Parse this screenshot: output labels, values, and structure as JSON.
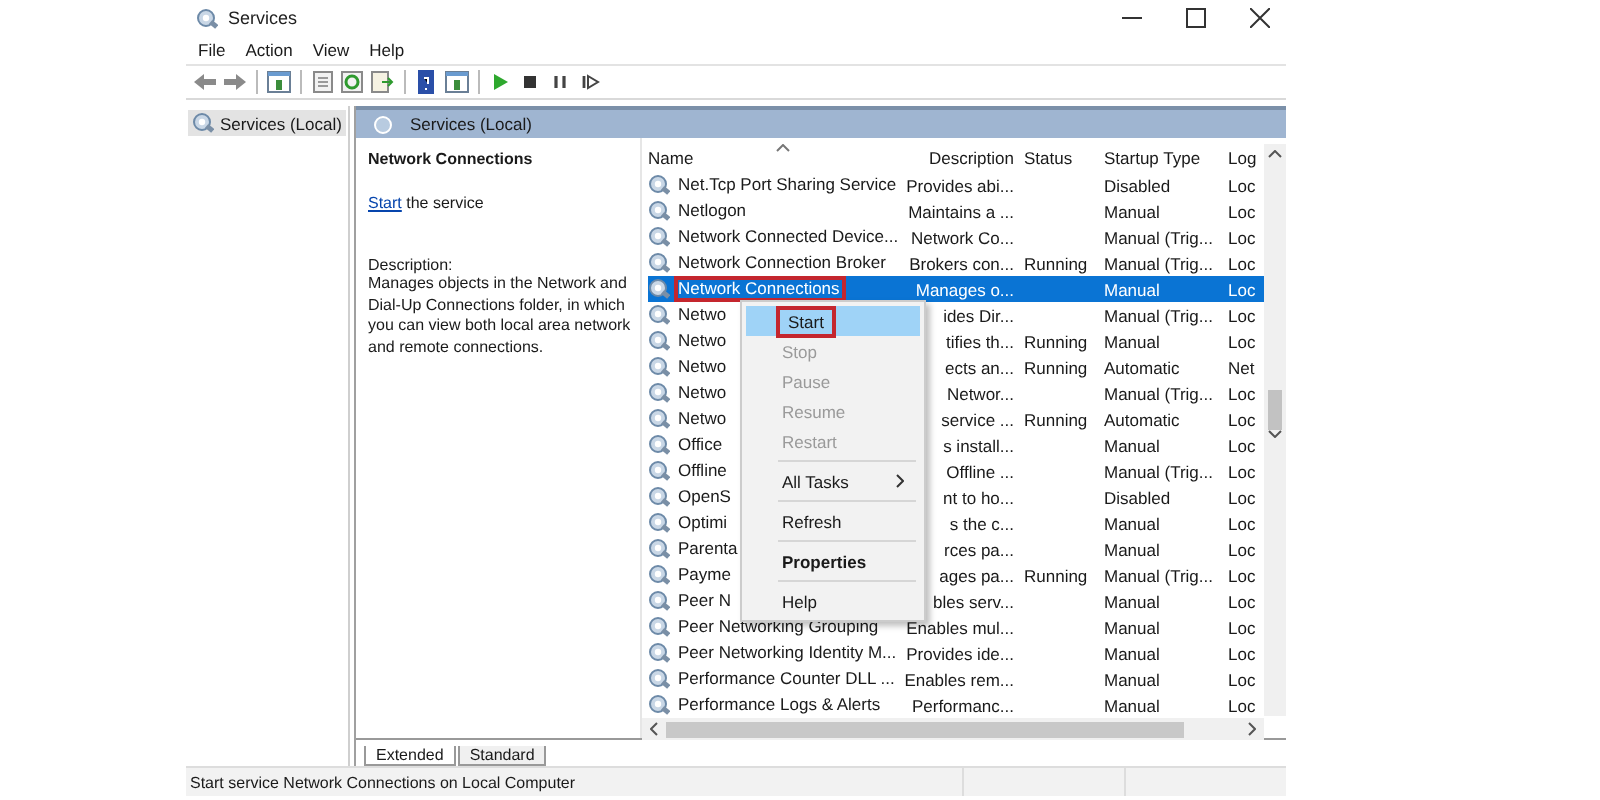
{
  "window": {
    "title": "Services"
  },
  "menu_bar": [
    "File",
    "Action",
    "View",
    "Help"
  ],
  "tree": [
    {
      "label": "Services (Local)",
      "selected": true
    }
  ],
  "pane_header": "Services (Local)",
  "details": {
    "title": "Network Connections",
    "action_link": "Start",
    "action_text": "the service",
    "description_label": "Description:",
    "description": "Manages objects in the Network and Dial-Up Connections folder, in which you can view both local area network and remote connections."
  },
  "table": {
    "columns": [
      {
        "label": "Name",
        "sorted": true
      },
      {
        "label": "Description",
        "sorted": false
      },
      {
        "label": "Status",
        "sorted": false
      },
      {
        "label": "Startup Type",
        "sorted": false
      },
      {
        "label": "Log",
        "sorted": false
      }
    ],
    "rows": [
      {
        "name": "Net.Tcp Port Sharing Service",
        "description": "Provides abi...",
        "status": "",
        "startup": "Disabled",
        "log": "Loc",
        "selected": false,
        "outlined": false
      },
      {
        "name": "Netlogon",
        "description": "Maintains a ...",
        "status": "",
        "startup": "Manual",
        "log": "Loc",
        "selected": false,
        "outlined": false
      },
      {
        "name": "Network Connected Device...",
        "description": "Network Co...",
        "status": "",
        "startup": "Manual (Trig...",
        "log": "Loc",
        "selected": false,
        "outlined": false
      },
      {
        "name": "Network Connection Broker",
        "description": "Brokers con...",
        "status": "Running",
        "startup": "Manual (Trig...",
        "log": "Loc",
        "selected": false,
        "outlined": false
      },
      {
        "name": "Network Connections",
        "description": "Manages o...",
        "status": "",
        "startup": "Manual",
        "log": "Loc",
        "selected": true,
        "outlined": true
      },
      {
        "name": "Netwo",
        "description": "ides Dir...",
        "status": "",
        "startup": "Manual (Trig...",
        "log": "Loc",
        "selected": false,
        "outlined": false
      },
      {
        "name": "Netwo",
        "description": "tifies th...",
        "status": "Running",
        "startup": "Manual",
        "log": "Loc",
        "selected": false,
        "outlined": false
      },
      {
        "name": "Netwo",
        "description": "ects an...",
        "status": "Running",
        "startup": "Automatic",
        "log": "Net",
        "selected": false,
        "outlined": false
      },
      {
        "name": "Netwo",
        "description": "Networ...",
        "status": "",
        "startup": "Manual (Trig...",
        "log": "Loc",
        "selected": false,
        "outlined": false
      },
      {
        "name": "Netwo",
        "description": "service ...",
        "status": "Running",
        "startup": "Automatic",
        "log": "Loc",
        "selected": false,
        "outlined": false
      },
      {
        "name": "Office",
        "description": "s install...",
        "status": "",
        "startup": "Manual",
        "log": "Loc",
        "selected": false,
        "outlined": false
      },
      {
        "name": "Offline",
        "description": "Offline ...",
        "status": "",
        "startup": "Manual (Trig...",
        "log": "Loc",
        "selected": false,
        "outlined": false
      },
      {
        "name": "OpenS",
        "description": "nt to ho...",
        "status": "",
        "startup": "Disabled",
        "log": "Loc",
        "selected": false,
        "outlined": false
      },
      {
        "name": "Optimi",
        "description": "s the c...",
        "status": "",
        "startup": "Manual",
        "log": "Loc",
        "selected": false,
        "outlined": false
      },
      {
        "name": "Parenta",
        "description": "rces pa...",
        "status": "",
        "startup": "Manual",
        "log": "Loc",
        "selected": false,
        "outlined": false
      },
      {
        "name": "Payme",
        "description": "ages pa...",
        "status": "Running",
        "startup": "Manual (Trig...",
        "log": "Loc",
        "selected": false,
        "outlined": false
      },
      {
        "name": "Peer N",
        "description": "bles serv...",
        "status": "",
        "startup": "Manual",
        "log": "Loc",
        "selected": false,
        "outlined": false
      },
      {
        "name": "Peer Networking Grouping",
        "description": "Enables mul...",
        "status": "",
        "startup": "Manual",
        "log": "Loc",
        "selected": false,
        "outlined": false
      },
      {
        "name": "Peer Networking Identity M...",
        "description": "Provides ide...",
        "status": "",
        "startup": "Manual",
        "log": "Loc",
        "selected": false,
        "outlined": false
      },
      {
        "name": "Performance Counter DLL ...",
        "description": "Enables rem...",
        "status": "",
        "startup": "Manual",
        "log": "Loc",
        "selected": false,
        "outlined": false
      },
      {
        "name": "Performance Logs & Alerts",
        "description": "Performanc...",
        "status": "",
        "startup": "Manual",
        "log": "Loc",
        "selected": false,
        "outlined": false
      }
    ]
  },
  "context_menu": [
    {
      "kind": "item",
      "label": "Start",
      "disabled": false,
      "selected": true,
      "outlined": true
    },
    {
      "kind": "item",
      "label": "Stop",
      "disabled": true,
      "selected": false,
      "outlined": false
    },
    {
      "kind": "item",
      "label": "Pause",
      "disabled": true,
      "selected": false,
      "outlined": false
    },
    {
      "kind": "item",
      "label": "Resume",
      "disabled": true,
      "selected": false,
      "outlined": false
    },
    {
      "kind": "item",
      "label": "Restart",
      "disabled": true,
      "selected": false,
      "outlined": false
    },
    {
      "kind": "separator"
    },
    {
      "kind": "submenu",
      "label": "All Tasks",
      "disabled": false,
      "selected": false,
      "outlined": false
    },
    {
      "kind": "separator"
    },
    {
      "kind": "item",
      "label": "Refresh",
      "disabled": false,
      "selected": false,
      "outlined": false
    },
    {
      "kind": "separator"
    },
    {
      "kind": "default",
      "label": "Properties",
      "disabled": false,
      "selected": false,
      "outlined": false
    },
    {
      "kind": "separator"
    },
    {
      "kind": "item",
      "label": "Help",
      "disabled": false,
      "selected": false,
      "outlined": false
    }
  ],
  "view_tabs": [
    {
      "label": "Extended",
      "selected": true
    },
    {
      "label": "Standard",
      "selected": false
    }
  ],
  "status_bar": "Start service Network Connections on Local Computer"
}
